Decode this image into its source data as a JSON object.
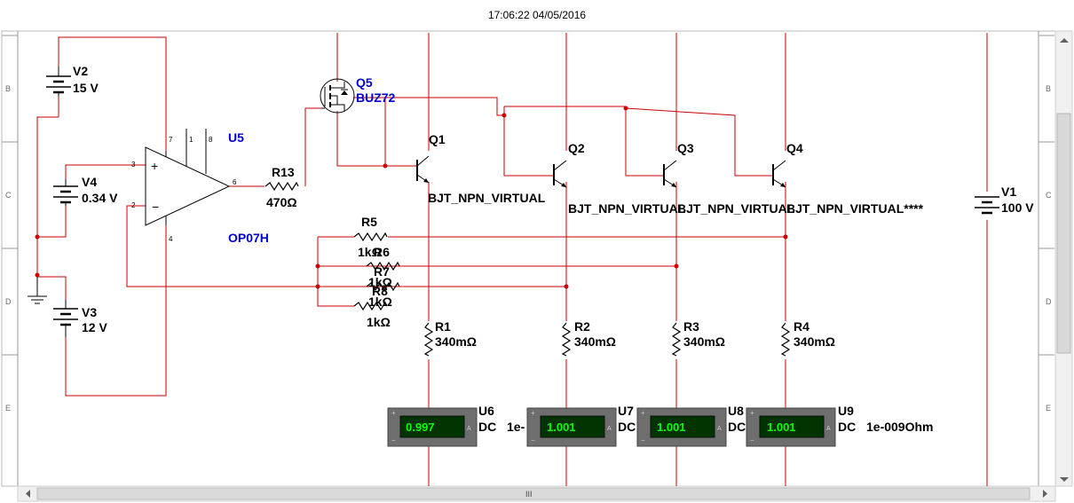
{
  "timestamp": "17:06:22 04/05/2016",
  "ruler_rows": [
    "B",
    "C",
    "D",
    "E"
  ],
  "components": {
    "V2": {
      "ref": "V2",
      "value": "15 V"
    },
    "V4": {
      "ref": "V4",
      "value": "0.34 V"
    },
    "V3": {
      "ref": "V3",
      "value": "12 V"
    },
    "V1": {
      "ref": "V1",
      "value": "100 V"
    },
    "U5": {
      "ref": "U5",
      "model": "OP07H",
      "pins": [
        "3",
        "2",
        "4",
        "6",
        "7",
        "1",
        "8"
      ]
    },
    "Q5": {
      "ref": "Q5",
      "model": "BUZ72"
    },
    "R13": {
      "ref": "R13",
      "value": "470Ω"
    },
    "R5": {
      "ref": "R5",
      "value": "1kΩ"
    },
    "R6": {
      "ref": "R6",
      "value": "1kΩ"
    },
    "R7": {
      "ref": "R7",
      "value": "1kΩ"
    },
    "R8": {
      "ref": "R8",
      "value": "1kΩ"
    },
    "Q1": {
      "ref": "Q1",
      "model": "BJT_NPN_VIRTUAL"
    },
    "Q2": {
      "ref": "Q2",
      "model": "BJT_NPN_VIRTUAL"
    },
    "Q3": {
      "ref": "Q3",
      "model": "BJT_NPN_VIRTUAL"
    },
    "Q4": {
      "ref": "Q4",
      "model": "BJT_NPN_VIRTUAL****"
    },
    "R1": {
      "ref": "R1",
      "value": "340mΩ"
    },
    "R2": {
      "ref": "R2",
      "value": "340mΩ"
    },
    "R3": {
      "ref": "R3",
      "value": "340mΩ"
    },
    "R4": {
      "ref": "R4",
      "value": "340mΩ"
    }
  },
  "meters": [
    {
      "ref": "U6",
      "reading": "0.997",
      "mode": "DC",
      "extra": "1e-"
    },
    {
      "ref": "U7",
      "reading": "1.001",
      "mode": "DC",
      "extra": ""
    },
    {
      "ref": "U8",
      "reading": "1.001",
      "mode": "DC",
      "extra": ""
    },
    {
      "ref": "U9",
      "reading": "1.001",
      "mode": "DC",
      "extra": "1e-009Ohm"
    }
  ],
  "scrollbar": {
    "grip": "III"
  },
  "colors": {
    "wire": "#cc0000",
    "meter_display": "#003300",
    "meter_text": "#00ff00",
    "meter_body": "#6e6e6e",
    "label_blue": "#0000cc"
  }
}
